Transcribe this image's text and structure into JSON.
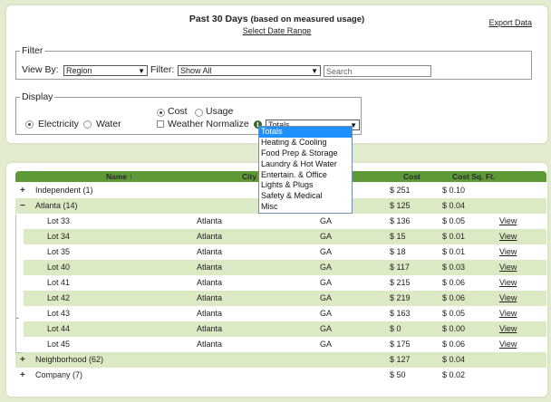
{
  "header": {
    "title": "Past 30 Days",
    "subtitle": "(based on measured usage)",
    "select_date_range": "Select Date Range",
    "export_data": "Export Data"
  },
  "filter": {
    "legend": "Filter",
    "view_by_label": "View By:",
    "view_by_value": "Region",
    "filter_label": "Filter:",
    "filter_value": "Show All",
    "search_placeholder": "Search"
  },
  "display": {
    "legend": "Display",
    "electricity": "Electricity",
    "water": "Water",
    "cost": "Cost",
    "usage": "Usage",
    "weather_normalize": "Weather Normalize",
    "category_value": "Totals",
    "options": [
      "Totals",
      "Heating & Cooling",
      "Food Prep & Storage",
      "Laundry & Hot Water",
      "Entertain. & Office",
      "Lights & Plugs",
      "Safety & Medical",
      "Misc"
    ]
  },
  "table": {
    "columns": {
      "name": "Name ↑",
      "city": "City",
      "cost": "Cost",
      "cost_sqft": "Cost Sq. Ft."
    },
    "groups": [
      {
        "toggle": "+",
        "name": "Independent (1)",
        "cost": "$ 251",
        "cost_sqft": "$ 0.10"
      },
      {
        "toggle": "−",
        "name": "Atlanta (14)",
        "cost": "$ 125",
        "cost_sqft": "$ 0.04"
      },
      {
        "toggle": "+",
        "name": "Neighborhood (62)",
        "cost": "$ 127",
        "cost_sqft": "$ 0.04"
      },
      {
        "toggle": "+",
        "name": "Company (7)",
        "cost": "$ 50",
        "cost_sqft": "$ 0.02"
      }
    ],
    "rows": [
      {
        "name": "Lot 33",
        "city": "Atlanta",
        "state": "GA",
        "cost": "$ 136",
        "cost_sqft": "$ 0.05",
        "action": "View"
      },
      {
        "name": "Lot 34",
        "city": "Atlanta",
        "state": "GA",
        "cost": "$ 15",
        "cost_sqft": "$ 0.01",
        "action": "View"
      },
      {
        "name": "Lot 35",
        "city": "Atlanta",
        "state": "GA",
        "cost": "$ 18",
        "cost_sqft": "$ 0.01",
        "action": "View"
      },
      {
        "name": "Lot 40",
        "city": "Atlanta",
        "state": "GA",
        "cost": "$ 117",
        "cost_sqft": "$ 0.03",
        "action": "View"
      },
      {
        "name": "Lot 41",
        "city": "Atlanta",
        "state": "GA",
        "cost": "$ 215",
        "cost_sqft": "$ 0.06",
        "action": "View"
      },
      {
        "name": "Lot 42",
        "city": "Atlanta",
        "state": "GA",
        "cost": "$ 219",
        "cost_sqft": "$ 0.06",
        "action": "View"
      },
      {
        "name": "Lot 43",
        "city": "Atlanta",
        "state": "GA",
        "cost": "$ 163",
        "cost_sqft": "$ 0.05",
        "action": "View"
      },
      {
        "name": "Lot 44",
        "city": "Atlanta",
        "state": "GA",
        "cost": "$ 0",
        "cost_sqft": "$ 0.00",
        "action": "View"
      },
      {
        "name": "Lot 45",
        "city": "Atlanta",
        "state": "GA",
        "cost": "$ 175",
        "cost_sqft": "$ 0.06",
        "action": "View"
      }
    ],
    "collapse_caret": "ˆ"
  },
  "colors": {
    "header_green": "#5d9a36",
    "row_green": "#dbe9c4",
    "background": "#e3ecd0",
    "dropdown_selected": "#1e90ff"
  }
}
